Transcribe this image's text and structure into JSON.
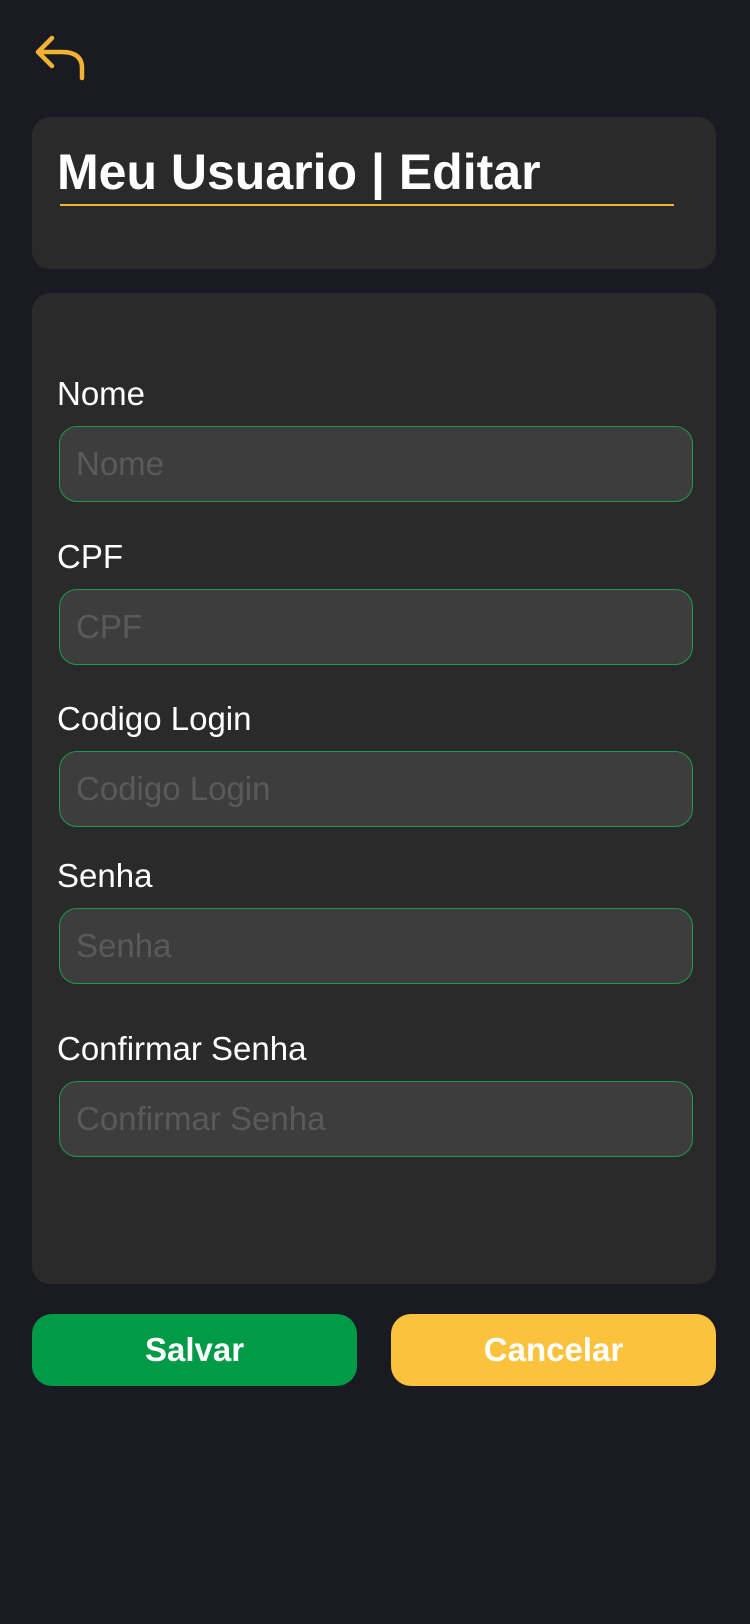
{
  "header": {
    "back_icon": "back-arrow-icon",
    "title": "Meu Usuario | Editar"
  },
  "form": {
    "fields": [
      {
        "label": "Nome",
        "placeholder": "Nome",
        "value": ""
      },
      {
        "label": "CPF",
        "placeholder": "CPF",
        "value": ""
      },
      {
        "label": "Codigo Login",
        "placeholder": "Codigo Login",
        "value": ""
      },
      {
        "label": "Senha",
        "placeholder": "Senha",
        "value": ""
      },
      {
        "label": "Confirmar Senha",
        "placeholder": "Confirmar Senha",
        "value": ""
      }
    ]
  },
  "actions": {
    "save_label": "Salvar",
    "cancel_label": "Cancelar"
  },
  "colors": {
    "background": "#1a1a22",
    "card": "#2a2a2a",
    "input_bg": "#3d3d3d",
    "input_border": "#1d9a4c",
    "accent_yellow": "#fbc23e",
    "save_green": "#019a47"
  }
}
